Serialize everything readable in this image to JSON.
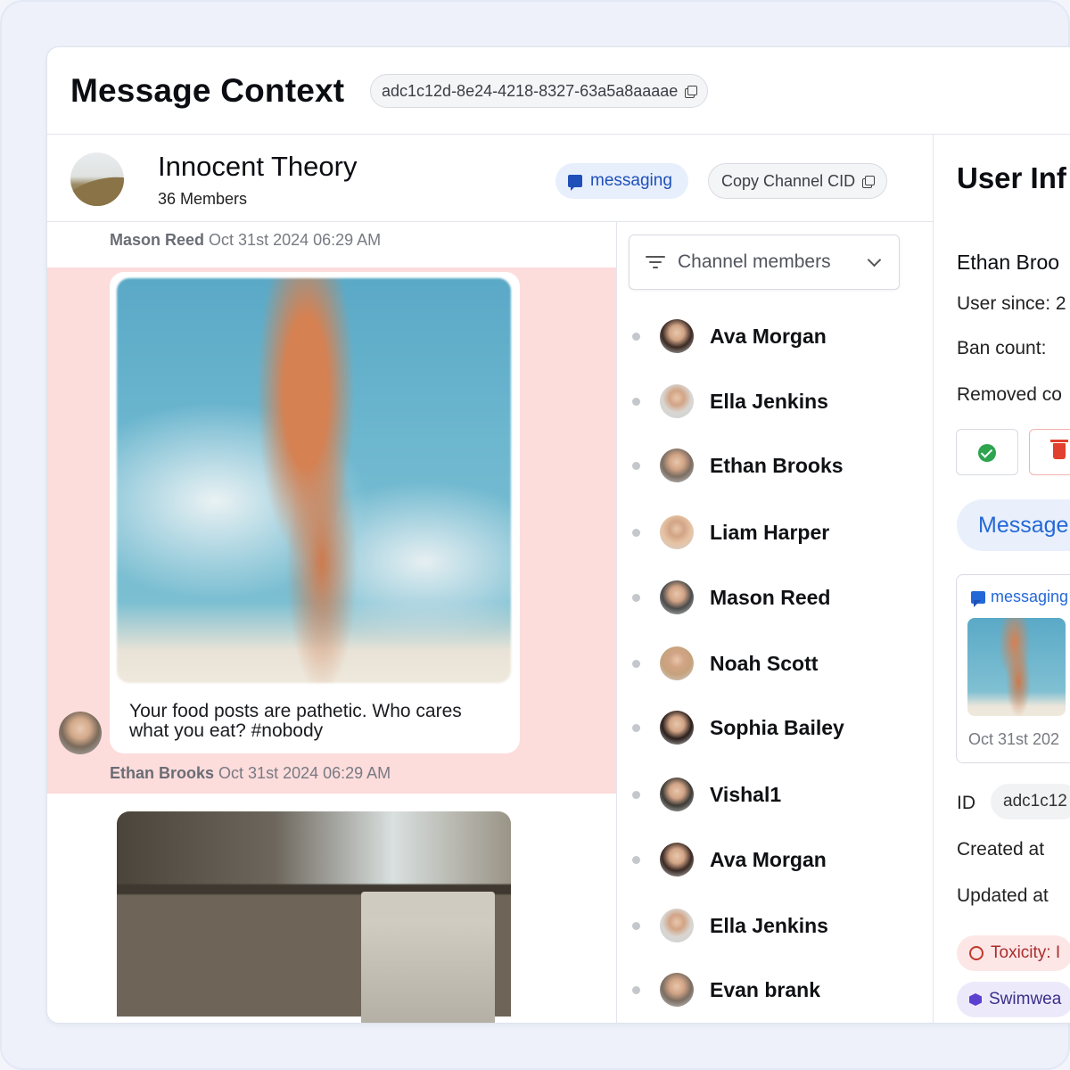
{
  "header": {
    "title": "Message Context",
    "message_id": "adc1c12d-8e24-4218-8327-63a5a8aaaae"
  },
  "channel": {
    "name": "Innocent Theory",
    "members_label": "36 Members",
    "type_tag": "messaging",
    "copy_cid_label": "Copy Channel CID"
  },
  "messages": [
    {
      "author": "Mason Reed",
      "timestamp": "Oct 31st 2024 06:29 AM"
    },
    {
      "author": "Ethan Brooks",
      "timestamp": "Oct 31st 2024 06:29 AM",
      "text": "Your food posts are pathetic. Who cares what you eat? #nobody",
      "flagged": true
    }
  ],
  "members_panel": {
    "filter_label": "Channel members",
    "members": [
      {
        "name": "Ava Morgan",
        "color": "#3a2a24"
      },
      {
        "name": "Ella Jenkins",
        "color": "#d9d6d2"
      },
      {
        "name": "Ethan Brooks",
        "color": "#7b6d62"
      },
      {
        "name": "Liam Harper",
        "color": "#e6c3a4"
      },
      {
        "name": "Mason Reed",
        "color": "#4b4b4b"
      },
      {
        "name": "Noah Scott",
        "color": "#c6a27c"
      },
      {
        "name": "Sophia Bailey",
        "color": "#2a1f1c"
      },
      {
        "name": "Vishal1",
        "color": "#3d3a36"
      },
      {
        "name": "Ava Morgan",
        "color": "#3a2a24"
      },
      {
        "name": "Ella Jenkins",
        "color": "#d9d6d2"
      },
      {
        "name": "Evan brank",
        "color": "#7b6d62"
      }
    ]
  },
  "user_info": {
    "title": "User Inf",
    "name": "Ethan Broo",
    "user_since_label": "User since: 2",
    "ban_count_label": "Ban count:",
    "removed_label": "Removed co",
    "message_button": "Message",
    "card": {
      "tag": "messaging",
      "date": "Oct 31st 202"
    },
    "id_label": "ID",
    "id_value": "adc1c12",
    "created_label": "Created at",
    "updated_label": "Updated at",
    "toxicity_tag": "Toxicity: I",
    "swim_tag": "Swimwea"
  }
}
